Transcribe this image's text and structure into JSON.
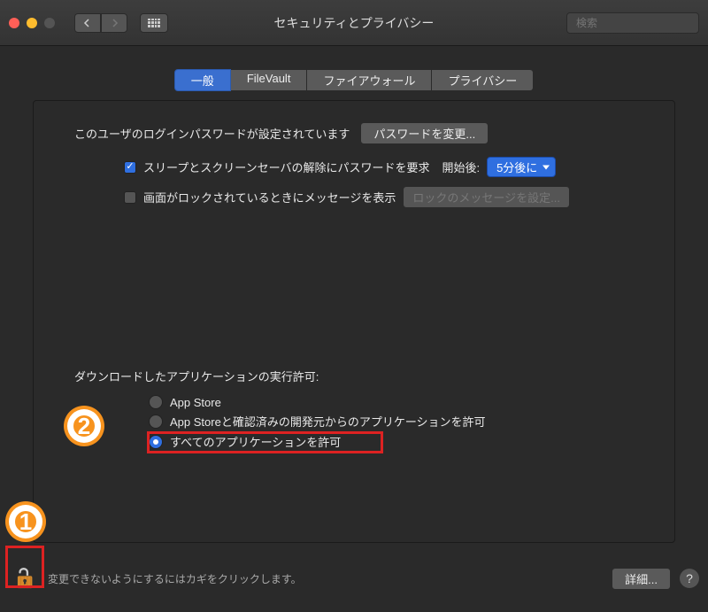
{
  "window": {
    "title": "セキュリティとプライバシー"
  },
  "search": {
    "placeholder": "検索"
  },
  "tabs": {
    "general": "一般",
    "filevault": "FileVault",
    "firewall": "ファイアウォール",
    "privacy": "プライバシー"
  },
  "login": {
    "password_set_label": "このユーザのログインパスワードが設定されています",
    "change_password_button": "パスワードを変更...",
    "require_password_label": "スリープとスクリーンセーバの解除にパスワードを要求",
    "start_after_label": "開始後:",
    "start_after_value": "5分後に",
    "lock_message_label": "画面がロックされているときにメッセージを表示",
    "set_lock_message_button": "ロックのメッセージを設定..."
  },
  "gatekeeper": {
    "section_label": "ダウンロードしたアプリケーションの実行許可:",
    "option_appstore": "App Store",
    "option_identified": "App Storeと確認済みの開発元からのアプリケーションを許可",
    "option_anywhere": "すべてのアプリケーションを許可"
  },
  "footer": {
    "lock_text": "変更できないようにするにはカギをクリックします。",
    "details_button": "詳細...",
    "help": "?"
  },
  "annotations": {
    "one": "1",
    "two": "2"
  }
}
